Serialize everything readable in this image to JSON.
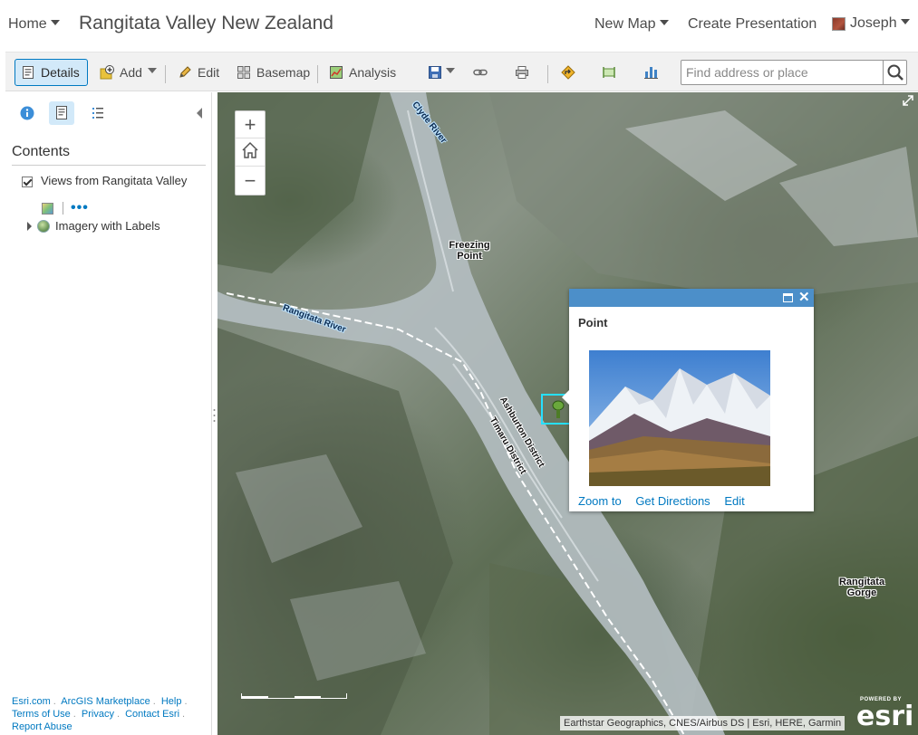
{
  "header": {
    "home_label": "Home",
    "title": "Rangitata Valley New Zealand",
    "new_map_label": "New Map",
    "create_presentation_label": "Create Presentation",
    "user_name": "Joseph"
  },
  "toolbar": {
    "details_label": "Details",
    "add_label": "Add",
    "edit_label": "Edit",
    "basemap_label": "Basemap",
    "analysis_label": "Analysis",
    "search_placeholder": "Find address or place",
    "icons": [
      "details-icon",
      "add-icon",
      "pencil-icon",
      "basemap-grid-icon",
      "analysis-icon",
      "save-icon",
      "link-icon",
      "print-icon",
      "directions-icon",
      "measure-icon",
      "bookmarks-icon",
      "search-icon"
    ]
  },
  "left_panel": {
    "contents_title": "Contents",
    "layers": [
      {
        "label": "Views from Rangitata Valley",
        "checked": true
      },
      {
        "label": "Imagery with Labels"
      }
    ],
    "more_label": "•••",
    "footer_links": [
      "Esri.com",
      "ArcGIS Marketplace",
      "Help",
      "Terms of Use",
      "Privacy",
      "Contact Esri",
      "Report Abuse"
    ]
  },
  "map": {
    "labels": {
      "clyde_river": "Clyde River",
      "freezing_point": "Freezing Point",
      "rangitata_river": "Rangitata River",
      "ashburton_district": "Ashburton District",
      "timaru_district": "Timaru District",
      "rangitata_gorge": "Rangitata Gorge"
    },
    "zoom_in": "+",
    "zoom_out": "−",
    "attribution": "Earthstar Geographics, CNES/Airbus DS | Esri, HERE, Garmin",
    "powered_by": "POWERED BY",
    "logo_text": "esri"
  },
  "popup": {
    "title": "Point",
    "zoom_to": "Zoom to",
    "get_directions": "Get Directions",
    "edit": "Edit"
  },
  "colors": {
    "accent": "#0079c1",
    "popup_header": "#4c8fc9",
    "selection": "#26e0ff"
  }
}
